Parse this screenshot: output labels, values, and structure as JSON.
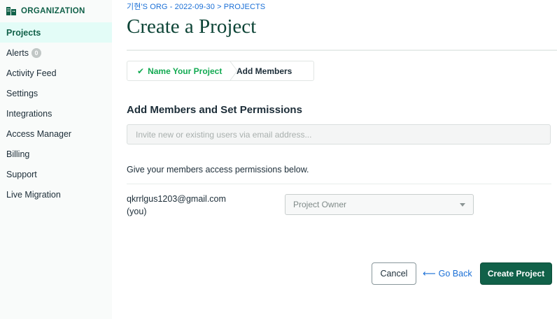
{
  "sidebar": {
    "org_label": "ORGANIZATION",
    "items": [
      {
        "label": "Projects"
      },
      {
        "label": "Alerts",
        "badge": "0"
      },
      {
        "label": "Activity Feed"
      },
      {
        "label": "Settings"
      },
      {
        "label": "Integrations"
      },
      {
        "label": "Access Manager"
      },
      {
        "label": "Billing"
      },
      {
        "label": "Support"
      },
      {
        "label": "Live Migration"
      }
    ]
  },
  "header": {
    "breadcrumb": "기현'S ORG - 2022-09-30 > PROJECTS",
    "title": "Create a Project"
  },
  "steps": [
    {
      "label": "Name Your Project",
      "state": "complete"
    },
    {
      "label": "Add Members",
      "state": "current"
    }
  ],
  "members_section": {
    "title": "Add Members and Set Permissions",
    "invite_placeholder": "Invite new or existing users via email address...",
    "permissions_text": "Give your members access permissions below.",
    "member": {
      "email": "qkrrlgus1203@gmail.com",
      "note": "(you)",
      "role": "Project Owner"
    }
  },
  "actions": {
    "cancel": "Cancel",
    "back": "Go Back",
    "create": "Create Project"
  },
  "colors": {
    "brand_green": "#116149",
    "success_green": "#13aa52",
    "link_blue": "#1a6fd6",
    "active_bg": "#e3fcf7"
  }
}
